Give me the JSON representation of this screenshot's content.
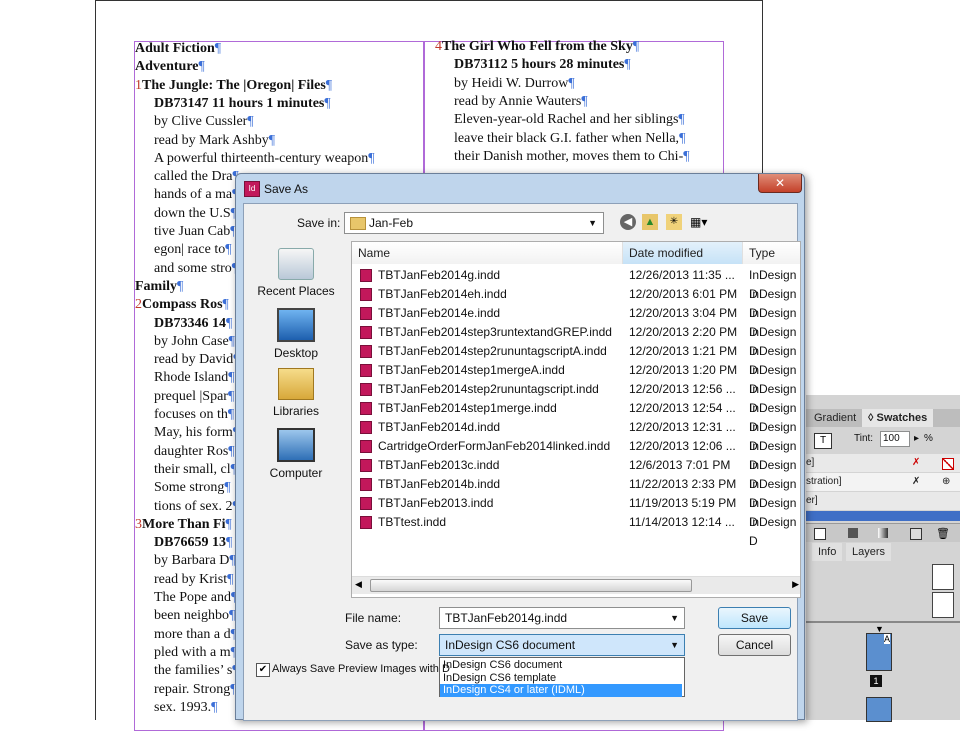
{
  "document": {
    "left_column": [
      {
        "text": "Adult Fiction",
        "bold": true
      },
      {
        "text": "Adventure",
        "bold": true
      },
      {
        "num": "1",
        "text": "The Jungle: The |Oregon| Files",
        "bold": true
      },
      {
        "text": "DB73147 11 hours 1 minutes",
        "bold": true,
        "indent": true
      },
      {
        "text": "by Clive Cussler",
        "indent": true
      },
      {
        "text": "read by Mark Ashby",
        "indent": true
      },
      {
        "text": "A powerful thirteenth-century weapon",
        "indent": true
      },
      {
        "text": "called the Dra",
        "indent": true
      },
      {
        "text": "hands of a ma",
        "indent": true
      },
      {
        "text": "down the U.S",
        "indent": true
      },
      {
        "text": "tive Juan Cab",
        "indent": true
      },
      {
        "text": "egon| race to",
        "indent": true
      },
      {
        "text": "and some stro",
        "indent": true
      },
      {
        "text": "Family",
        "bold": true
      },
      {
        "num": "2",
        "text": "Compass Ros",
        "bold": true
      },
      {
        "text": "DB73346 14",
        "bold": true,
        "indent": true
      },
      {
        "text": "by John Case",
        "indent": true
      },
      {
        "text": "read by David",
        "indent": true
      },
      {
        "text": "Rhode Island",
        "indent": true
      },
      {
        "text": "prequel |Spar",
        "indent": true
      },
      {
        "text": "focuses on th",
        "indent": true
      },
      {
        "text": "May, his form",
        "indent": true
      },
      {
        "text": "daughter Ros",
        "indent": true
      },
      {
        "text": "their small, cl",
        "indent": true
      },
      {
        "text": "Some strong",
        "indent": true
      },
      {
        "text": "tions of sex. 2",
        "indent": true
      },
      {
        "num": "3",
        "text": "More Than Fi",
        "bold": true
      },
      {
        "text": "DB76659 13",
        "bold": true,
        "indent": true
      },
      {
        "text": "by Barbara D",
        "indent": true
      },
      {
        "text": "read by Krist",
        "indent": true
      },
      {
        "text": "The Pope and",
        "indent": true
      },
      {
        "text": "been neighbo",
        "indent": true
      },
      {
        "text": "more than a d",
        "indent": true
      },
      {
        "text": "pled with a m",
        "indent": true
      },
      {
        "text": "the families’ s",
        "indent": true
      },
      {
        "text": "repair. Strong",
        "indent": true
      },
      {
        "text": "sex. 1993.",
        "indent": true
      }
    ],
    "right_column": [
      {
        "num": "4",
        "text": "The Girl Who Fell from the Sky",
        "bold": true
      },
      {
        "text": "DB73112 5 hours 28 minutes",
        "bold": true,
        "indent": true
      },
      {
        "text": "by Heidi W. Durrow",
        "indent": true
      },
      {
        "text": "read by Annie Wauters",
        "indent": true
      },
      {
        "text": "Eleven-year-old Rachel and her siblings",
        "indent": true
      },
      {
        "text": "leave their black G.I. father when Nella,",
        "indent": true
      },
      {
        "text": "their Danish mother, moves them to Chi-",
        "indent": true
      }
    ]
  },
  "panels": {
    "tabs": [
      "Gradient",
      "Swatches"
    ],
    "tint_label": "Tint:",
    "tint_value": "100",
    "tint_unit": "%",
    "swatch_rows": [
      "e]",
      "stration]",
      "er]"
    ],
    "bottom_tabs": [
      "Info",
      "Layers"
    ],
    "page_label": "1",
    "page_prefix": "A"
  },
  "dialog": {
    "title": "Save As",
    "save_in_label": "Save in:",
    "folder": "Jan-Feb",
    "places": [
      "Recent Places",
      "Desktop",
      "Libraries",
      "Computer"
    ],
    "columns": [
      "Name",
      "Date modified",
      "Type"
    ],
    "files": [
      {
        "name": "TBTJanFeb2014g.indd",
        "date": "12/26/2013 11:35 ...",
        "type": "InDesign D"
      },
      {
        "name": "TBTJanFeb2014eh.indd",
        "date": "12/20/2013 6:01 PM",
        "type": "InDesign D"
      },
      {
        "name": "TBTJanFeb2014e.indd",
        "date": "12/20/2013 3:04 PM",
        "type": "InDesign D"
      },
      {
        "name": "TBTJanFeb2014step3runtextandGREP.indd",
        "date": "12/20/2013 2:20 PM",
        "type": "InDesign D"
      },
      {
        "name": "TBTJanFeb2014step2rununtagscriptA.indd",
        "date": "12/20/2013 1:21 PM",
        "type": "InDesign D"
      },
      {
        "name": "TBTJanFeb2014step1mergeA.indd",
        "date": "12/20/2013 1:20 PM",
        "type": "InDesign D"
      },
      {
        "name": "TBTJanFeb2014step2rununtagscript.indd",
        "date": "12/20/2013 12:56 ...",
        "type": "InDesign D"
      },
      {
        "name": "TBTJanFeb2014step1merge.indd",
        "date": "12/20/2013 12:54 ...",
        "type": "InDesign D"
      },
      {
        "name": "TBTJanFeb2014d.indd",
        "date": "12/20/2013 12:31 ...",
        "type": "InDesign D"
      },
      {
        "name": "CartridgeOrderFormJanFeb2014linked.indd",
        "date": "12/20/2013 12:06 ...",
        "type": "InDesign D"
      },
      {
        "name": "TBTJanFeb2013c.indd",
        "date": "12/6/2013 7:01 PM",
        "type": "InDesign D"
      },
      {
        "name": "TBTJanFeb2014b.indd",
        "date": "11/22/2013 2:33 PM",
        "type": "InDesign D"
      },
      {
        "name": "TBTJanFeb2013.indd",
        "date": "11/19/2013 5:19 PM",
        "type": "InDesign D"
      },
      {
        "name": "TBTtest.indd",
        "date": "11/14/2013 12:14 ...",
        "type": "InDesign D"
      }
    ],
    "file_name_label": "File name:",
    "file_name_value": "TBTJanFeb2014g.indd",
    "save_type_label": "Save as type:",
    "save_type_value": "InDesign CS6 document",
    "type_options": [
      "InDesign CS6 document",
      "InDesign CS6 template",
      "InDesign CS4 or later (IDML)"
    ],
    "always_save_label": "Always Save Preview Images with D",
    "always_save_checked": true,
    "save_button": "Save",
    "cancel_button": "Cancel",
    "close_glyph": "✕"
  }
}
